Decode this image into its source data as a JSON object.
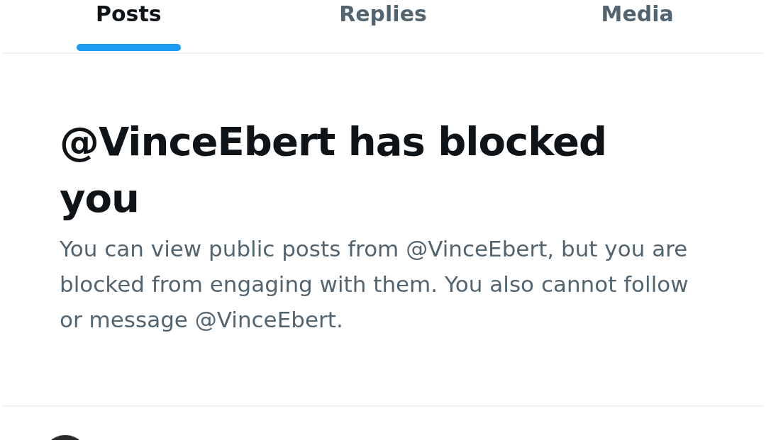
{
  "tabs": [
    {
      "label": "Posts",
      "selected": true
    },
    {
      "label": "Replies",
      "selected": false
    },
    {
      "label": "Media",
      "selected": false
    }
  ],
  "notice": {
    "title": "@VinceEbert has blocked you",
    "body": "You can view public posts from @VinceEbert, but you are blocked from engaging with them. You also cannot follow or message @VinceEbert."
  }
}
